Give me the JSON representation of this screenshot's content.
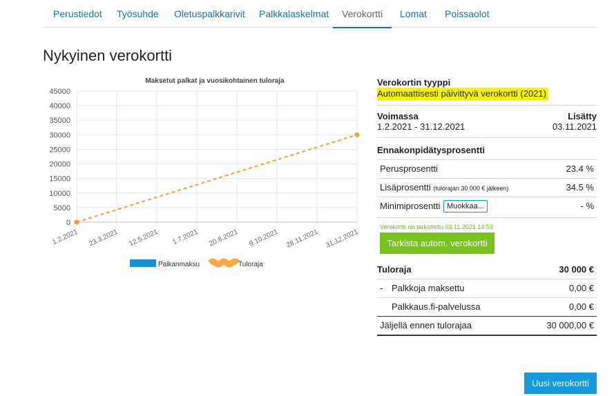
{
  "tabs": [
    "Perustiedot",
    "Työsuhde",
    "Oletuspalkkarivit",
    "Palkkalaskelmat",
    "Verokortti",
    "Lomat",
    "Poissaolot"
  ],
  "active_tab": "Verokortti",
  "page_title": "Nykyinen verokortti",
  "chart_data": {
    "type": "line",
    "title": "Maksetut palkat ja vuosikohtainen tuloraja",
    "categories": [
      "1.2.2021",
      "23.3.2021",
      "12.5.2021",
      "1.7.2021",
      "20.8.2021",
      "9.10.2021",
      "28.11.2021",
      "31.12.2021"
    ],
    "y_ticks": [
      "45000",
      "40000",
      "35000",
      "30000",
      "25000",
      "20000",
      "15000",
      "10000",
      "5000",
      "0"
    ],
    "ylim": [
      0,
      45000
    ],
    "series": [
      {
        "name": "Palkanmaksu",
        "color": "#1a8fd4",
        "points": [
          [
            "1.2.2021",
            0
          ]
        ]
      },
      {
        "name": "Tuloraja",
        "color": "#f5a030",
        "dashed": true,
        "points": [
          [
            "1.2.2021",
            0
          ],
          [
            "31.12.2021",
            30000
          ]
        ]
      }
    ],
    "grid": true,
    "legend": "bottom"
  },
  "card_type": {
    "label": "Verokortin tyyppi",
    "value": "Automaattisesti päivittyvä verokortti (2021)"
  },
  "validity": {
    "label": "Voimassa",
    "value": "1.2.2021 - 31.12.2021",
    "added_label": "Lisätty",
    "added_value": "03.11.2021"
  },
  "withholding": {
    "title": "Ennakonpidätysprosentti",
    "base_label": "Perusprosentti",
    "base_value": "23.4 %",
    "extra_label": "Lisäprosentti",
    "extra_note": "(tulorajan 30 000 € jälkeen)",
    "extra_value": "34.5 %",
    "min_label": "Minimiprosentti",
    "min_edit": "Muokkaa...",
    "min_value": "- %"
  },
  "check": {
    "note": "Verokortti on tarkistettu 03.11.2021 14:53",
    "button": "Tarkista autom. verokortti"
  },
  "income_limit": {
    "label": "Tuloraja",
    "value": "30 000 €",
    "paid_prefix": "-",
    "paid_label": "Palkkoja maksettu",
    "paid_value": "0,00 €",
    "service_label": "Palkkaus.fi-palvelussa",
    "service_value": "0,00 €",
    "remaining_label": "Jäljellä ennen tulorajaa",
    "remaining_value": "30 000,00 €"
  },
  "new_card_button": "Uusi verokortti",
  "colors": {
    "accent": "#1a8fd4",
    "green": "#78c31c",
    "highlight": "#f7f500",
    "orange": "#f5a030"
  }
}
